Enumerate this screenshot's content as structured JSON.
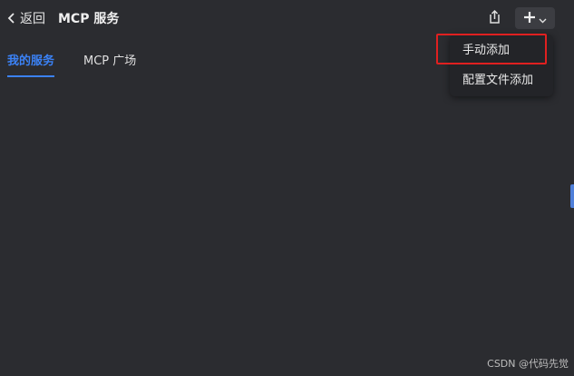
{
  "header": {
    "back_label": "返回",
    "title": "MCP 服务",
    "icons": {
      "back": "chevron-left-icon",
      "export": "export-icon",
      "add": "plus-icon",
      "dropdown": "chevron-down-icon"
    }
  },
  "tabs": [
    {
      "label": "我的服务",
      "active": true
    },
    {
      "label": "MCP 广场",
      "active": false
    }
  ],
  "add_menu": {
    "items": [
      {
        "label": "手动添加",
        "highlighted": true
      },
      {
        "label": "配置文件添加",
        "highlighted": false
      }
    ]
  },
  "watermark": "CSDN @代码先觉",
  "colors": {
    "background": "#2b2c30",
    "accent": "#3b82f6",
    "highlight_border": "#e02020",
    "menu_bg": "#232428"
  }
}
